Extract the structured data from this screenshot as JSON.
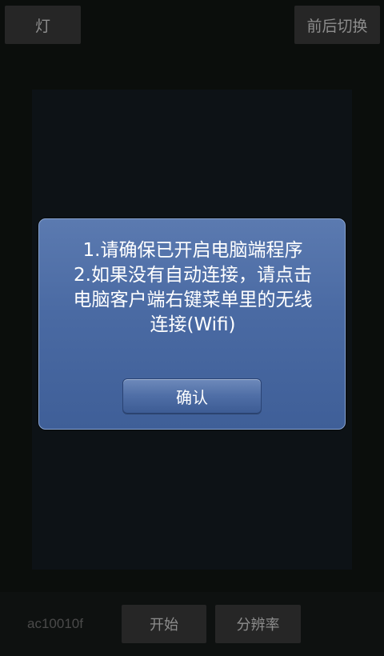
{
  "top_bar": {
    "light_label": "灯",
    "switch_camera_label": "前后切换"
  },
  "dialog": {
    "lines": [
      "1.请确保已开启电脑端程序",
      "2.如果没有自动连接，请点击",
      "电脑客户端右键菜单里的无线",
      "连接(Wifi)"
    ],
    "confirm_label": "确认"
  },
  "bottom_bar": {
    "device_id": "ac10010f",
    "start_label": "开始",
    "resolution_label": "分辨率"
  },
  "colors": {
    "dialog_bg": "#4a6aa3",
    "button_bg": "#262626",
    "button_text": "#8d8d8d"
  }
}
